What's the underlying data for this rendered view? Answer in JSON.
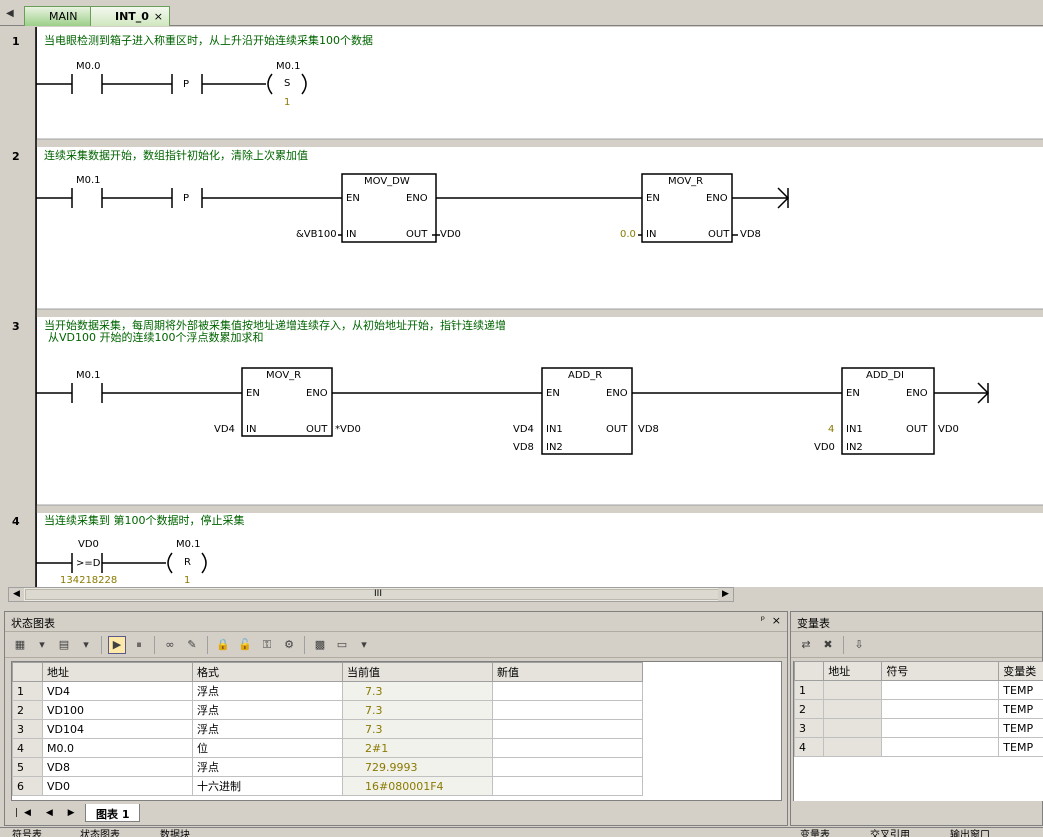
{
  "tabs": [
    {
      "label": "MAIN",
      "active": false
    },
    {
      "label": "INT_0",
      "active": true
    }
  ],
  "tab_close": "×",
  "networks": [
    {
      "num": "1",
      "comment": "当电眼检测到箱子进入称重区时，从上升沿开始连续采集100个数据"
    },
    {
      "num": "2",
      "comment": "连续采集数据开始，数组指针初始化，清除上次累加值"
    },
    {
      "num": "3",
      "comment": "当开始数据采集，每周期将外部被采集值按地址递增连续存入，从初始地址开始，指针连续递增",
      "comment2": "从VD100 开始的连续100个浮点数累加求和"
    },
    {
      "num": "4",
      "comment": "当连续采集到 第100个数据时，停止采集"
    }
  ],
  "net1": {
    "contact": "M0.0",
    "p": "P",
    "coil": "M0.1",
    "coil_type": "S",
    "coil_n": "1"
  },
  "net2": {
    "contact": "M0.1",
    "p": "P",
    "box1": {
      "title": "MOV_DW",
      "en": "EN",
      "eno": "ENO",
      "in": "IN",
      "out": "OUT",
      "in_val": "&VB100",
      "out_val": "VD0"
    },
    "box2": {
      "title": "MOV_R",
      "en": "EN",
      "eno": "ENO",
      "in": "IN",
      "out": "OUT",
      "in_val": "0.0",
      "out_val": "VD8"
    }
  },
  "net3": {
    "contact": "M0.1",
    "box1": {
      "title": "MOV_R",
      "en": "EN",
      "eno": "ENO",
      "in": "IN",
      "out": "OUT",
      "in_val": "VD4",
      "out_val": "*VD0"
    },
    "box2": {
      "title": "ADD_R",
      "en": "EN",
      "eno": "ENO",
      "in1": "IN1",
      "in2": "IN2",
      "out": "OUT",
      "in1_val": "VD4",
      "in2_val": "VD8",
      "out_val": "VD8"
    },
    "box3": {
      "title": "ADD_DI",
      "en": "EN",
      "eno": "ENO",
      "in1": "IN1",
      "in2": "IN2",
      "out": "OUT",
      "in1_val": "4",
      "in2_val": "VD0",
      "out_val": "VD0"
    }
  },
  "net4": {
    "operand": "VD0",
    "cmp": ">=D",
    "cmp_val": "134218228",
    "coil": "M0.1",
    "coil_type": "R",
    "coil_n": "1"
  },
  "hscroll_mark": "III",
  "status_chart": {
    "title": "状态图表",
    "pin": "ᵖ",
    "close": "×",
    "headers": [
      "",
      "地址",
      "格式",
      "当前值",
      "新值"
    ],
    "rows": [
      {
        "n": "1",
        "addr": "VD4",
        "fmt": "浮点",
        "cur": "7.3",
        "new": ""
      },
      {
        "n": "2",
        "addr": "VD100",
        "fmt": "浮点",
        "cur": "7.3",
        "new": ""
      },
      {
        "n": "3",
        "addr": "VD104",
        "fmt": "浮点",
        "cur": "7.3",
        "new": ""
      },
      {
        "n": "4",
        "addr": "M0.0",
        "fmt": "位",
        "cur": "2#1",
        "new": ""
      },
      {
        "n": "5",
        "addr": "VD8",
        "fmt": "浮点",
        "cur": "729.9993",
        "new": ""
      },
      {
        "n": "6",
        "addr": "VD0",
        "fmt": "十六进制",
        "cur": "16#080001F4",
        "new": ""
      }
    ],
    "sheet_nav": "|◀ ◀ ▶ ▶|",
    "sheet_tab": "图表 1"
  },
  "var_table": {
    "title": "变量表",
    "headers": [
      "",
      "地址",
      "符号",
      "变量类"
    ],
    "rows": [
      {
        "n": "1",
        "type": "TEMP"
      },
      {
        "n": "2",
        "type": "TEMP"
      },
      {
        "n": "3",
        "type": "TEMP"
      },
      {
        "n": "4",
        "type": "TEMP"
      }
    ]
  },
  "bottom_tabs": [
    "符号表",
    "状态图表",
    "数据块",
    "变量表",
    "交叉引用",
    "输出窗口"
  ],
  "colors": {
    "comment": "#006400",
    "value": "#8a7a00",
    "tab": "#9ccf8a"
  }
}
